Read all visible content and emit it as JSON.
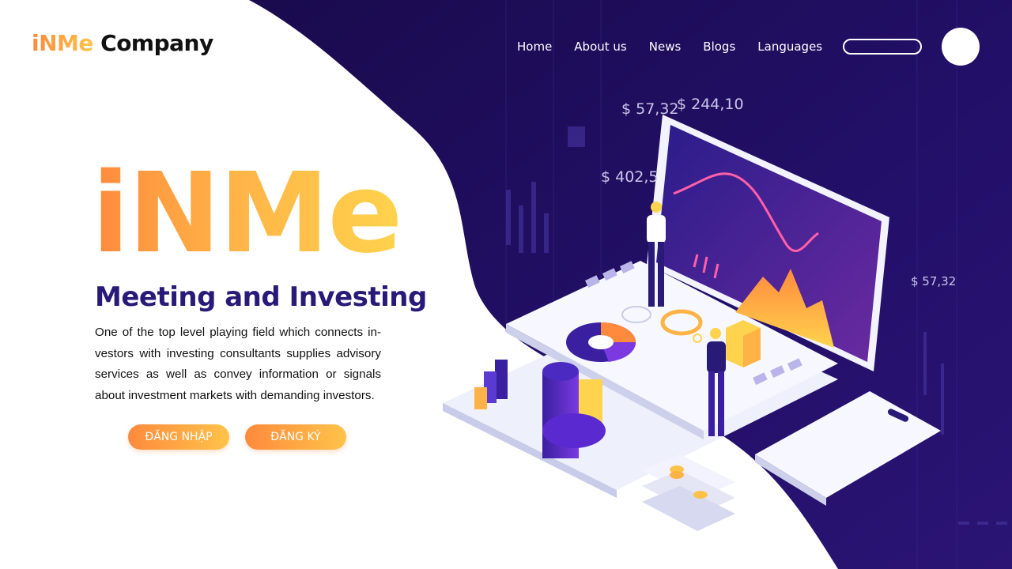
{
  "header": {
    "logo_brand": "iNMe",
    "logo_rest": " Company",
    "nav": [
      "Home",
      "About us",
      "News",
      "Blogs",
      "Languages"
    ]
  },
  "hero": {
    "title": "iNMe",
    "subtitle": "Meeting and Investing",
    "description": "One of the top level playing field which connects in-vestors with investing consultants supplies advisory services as well as convey information or signals about investment markets with demanding investors.",
    "login_label": "ĐĂNG NHẬP",
    "register_label": "ĐĂNG KÝ"
  },
  "illustration": {
    "prices": [
      "$ 57,32",
      "$ 244,10",
      "$ 402,5",
      "$ 57,32"
    ]
  },
  "colors": {
    "accent_orange": "#ff8a3d",
    "accent_yellow": "#ffc34a",
    "dark_purple": "#1e0f55",
    "text_purple": "#2a1a78"
  }
}
